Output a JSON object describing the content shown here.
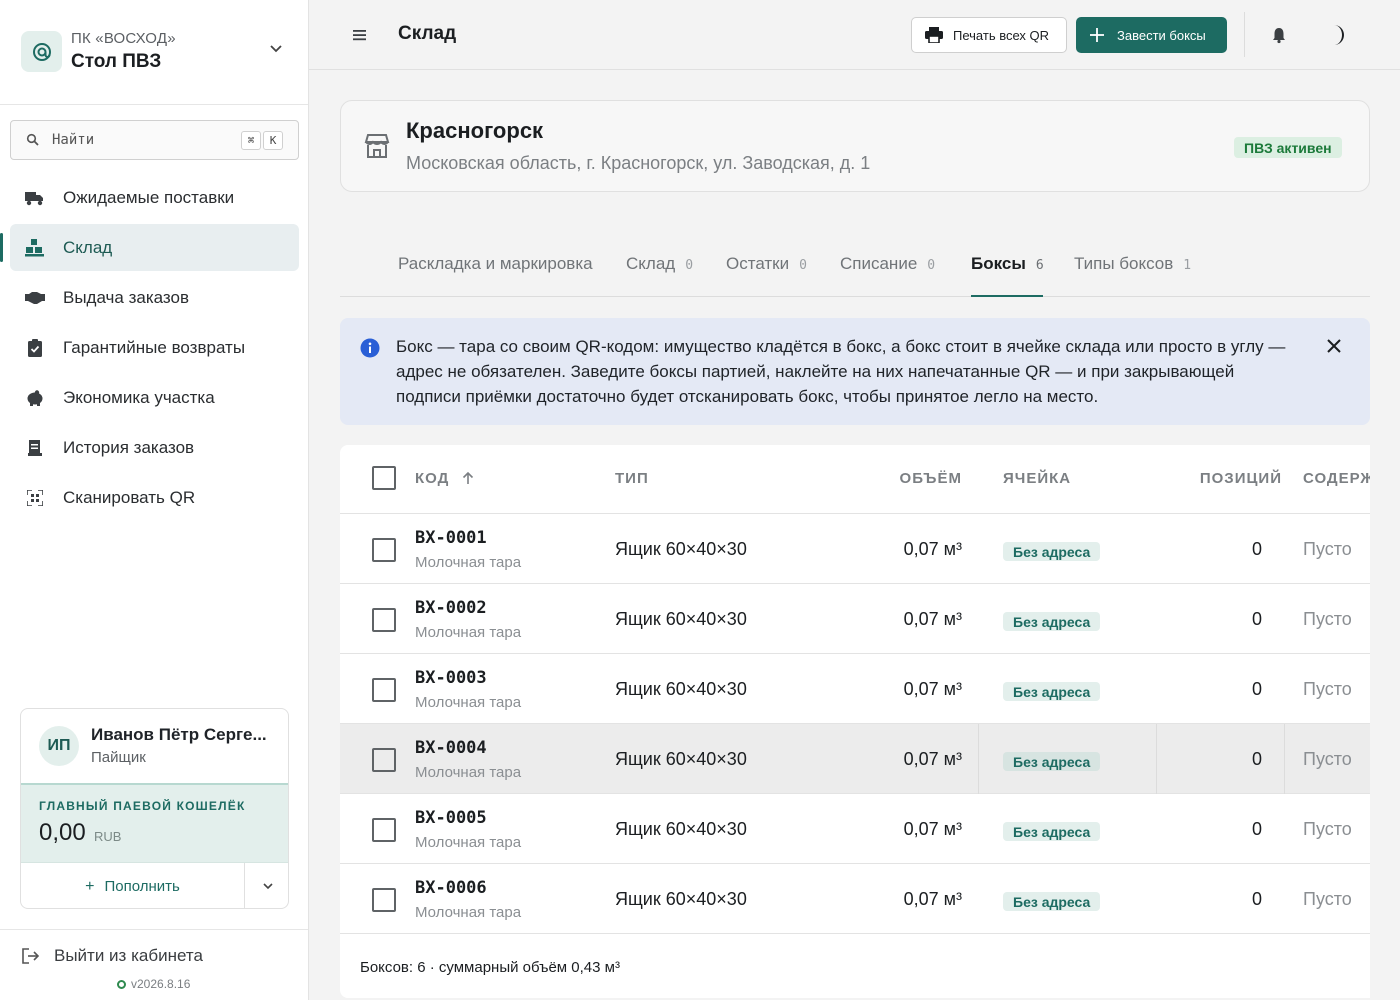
{
  "sidebar": {
    "org_sub": "ПК «ВОСХОД»",
    "org_name": "Стол ПВЗ",
    "search": {
      "placeholder": "Найти",
      "kbd1": "⌘",
      "kbd2": "K"
    },
    "nav": [
      {
        "label": "Ожидаемые поставки",
        "icon": "truck-icon"
      },
      {
        "label": "Склад",
        "icon": "warehouse-icon",
        "active": true
      },
      {
        "label": "Выдача заказов",
        "icon": "handshake-icon"
      },
      {
        "label": "Гарантийные возвраты",
        "icon": "clipboard-check-icon"
      },
      {
        "label": "Экономика участка",
        "icon": "piggy-bank-icon"
      },
      {
        "label": "История заказов",
        "icon": "receipt-icon"
      },
      {
        "label": "Сканировать QR",
        "icon": "qr-scan-icon"
      }
    ],
    "user": {
      "initials": "ИП",
      "name": "Иванов Пётр Серге...",
      "role": "Пайщик"
    },
    "wallet": {
      "title": "ГЛАВНЫЙ ПАЕВОЙ КОШЕЛЁК",
      "amount": "0,00",
      "currency": "RUB",
      "topup_label": "Пополнить"
    },
    "logout_label": "Выйти из кабинета",
    "version": "v2026.8.16"
  },
  "topbar": {
    "title": "Склад",
    "print_label": "Печать всех QR",
    "create_label": "Завести боксы"
  },
  "store": {
    "name": "Красногорск",
    "address": "Московская область, г. Красногорск, ул. Заводская, д. 1",
    "status": "ПВЗ активен"
  },
  "tabs": [
    {
      "label": "Раскладка и маркировка",
      "count": ""
    },
    {
      "label": "Склад",
      "count": "0"
    },
    {
      "label": "Остатки",
      "count": "0"
    },
    {
      "label": "Списание",
      "count": "0"
    },
    {
      "label": "Боксы",
      "count": "6",
      "active": true
    },
    {
      "label": "Типы боксов",
      "count": "1"
    }
  ],
  "alert": {
    "text": "Бокс — тара со своим QR-кодом: имущество кладётся в бокс, а бокс стоит в ячейке склада или просто в углу — адрес не обязателен. Заведите боксы партией, наклейте на них напечатанные QR — и при закрывающей подписи приёмки достаточно будет отсканировать бокс, чтобы принятое легло на место."
  },
  "table": {
    "headers": {
      "code": "КОД",
      "type": "ТИП",
      "volume": "ОБЪЁМ",
      "cell": "ЯЧЕЙКА",
      "positions": "ПОЗИЦИЙ",
      "content": "СОДЕРЖ"
    },
    "rows": [
      {
        "code": "BX-0001",
        "sub": "Молочная тара",
        "type": "Ящик 60×40×30",
        "volume": "0,07 м³",
        "cell": "Без адреса",
        "positions": "0",
        "content": "Пусто"
      },
      {
        "code": "BX-0002",
        "sub": "Молочная тара",
        "type": "Ящик 60×40×30",
        "volume": "0,07 м³",
        "cell": "Без адреса",
        "positions": "0",
        "content": "Пусто"
      },
      {
        "code": "BX-0003",
        "sub": "Молочная тара",
        "type": "Ящик 60×40×30",
        "volume": "0,07 м³",
        "cell": "Без адреса",
        "positions": "0",
        "content": "Пусто"
      },
      {
        "code": "BX-0004",
        "sub": "Молочная тара",
        "type": "Ящик 60×40×30",
        "volume": "0,07 м³",
        "cell": "Без адреса",
        "positions": "0",
        "content": "Пусто"
      },
      {
        "code": "BX-0005",
        "sub": "Молочная тара",
        "type": "Ящик 60×40×30",
        "volume": "0,07 м³",
        "cell": "Без адреса",
        "positions": "0",
        "content": "Пусто"
      },
      {
        "code": "BX-0006",
        "sub": "Молочная тара",
        "type": "Ящик 60×40×30",
        "volume": "0,07 м³",
        "cell": "Без адреса",
        "positions": "0",
        "content": "Пусто"
      }
    ],
    "footer": "Боксов: 6 · суммарный объём 0,43 м³"
  },
  "colors": {
    "accent": "#1d6b62",
    "active_badge": "#1c7a3a",
    "info_bg": "#e4e9f5"
  }
}
